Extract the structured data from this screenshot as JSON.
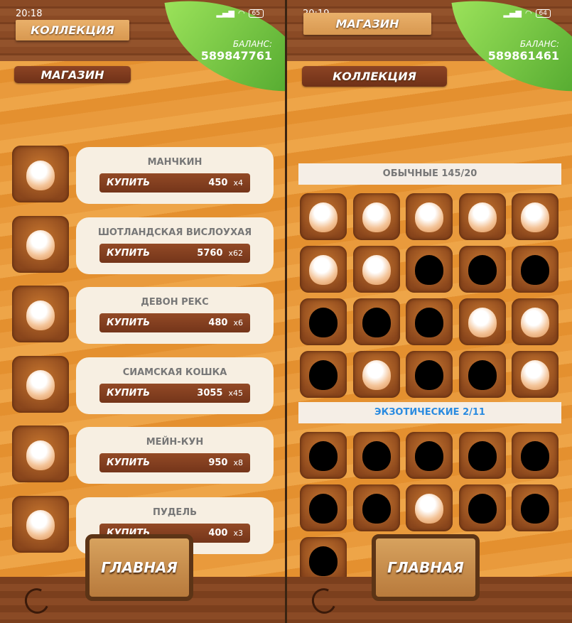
{
  "shop": {
    "time": "20:18",
    "battery": "65",
    "top_button": "КОЛЛЕКЦИЯ",
    "current_button": "МАГАЗИН",
    "balance_label": "БАЛАНС:",
    "balance": "589847761",
    "buy_label": "КУПИТЬ",
    "items": [
      {
        "name": "МАНЧКИН",
        "price": "450",
        "mult": "x4"
      },
      {
        "name": "ШОТЛАНДСКАЯ ВИСЛОУХАЯ",
        "price": "5760",
        "mult": "x62"
      },
      {
        "name": "ДЕВОН РЕКС",
        "price": "480",
        "mult": "x6"
      },
      {
        "name": "СИАМСКАЯ КОШКА",
        "price": "3055",
        "mult": "x45"
      },
      {
        "name": "МЕЙН-КУН",
        "price": "950",
        "mult": "x8"
      },
      {
        "name": "ПУДЕЛЬ",
        "price": "400",
        "mult": "x3"
      }
    ],
    "home_button": "ГЛАВНАЯ"
  },
  "collection": {
    "time": "20:19",
    "battery": "64",
    "top_button": "МАГАЗИН",
    "current_button": "КОЛЛЕКЦИЯ",
    "balance_label": "БАЛАНС:",
    "balance": "589861461",
    "common_title": "ОБЫЧНЫЕ 145/20",
    "common_unlocked": [
      true,
      true,
      true,
      true,
      true,
      true,
      true,
      false,
      false,
      false,
      false,
      false,
      false,
      true,
      true,
      false,
      true,
      false,
      false,
      true
    ],
    "exotic_title": "ЭКЗОТИЧЕСКИЕ 2/11",
    "exotic_unlocked": [
      false,
      false,
      false,
      false,
      false,
      false,
      false,
      true,
      false,
      false,
      false
    ],
    "home_button": "ГЛАВНАЯ"
  },
  "colors": {
    "accent_blue": "#2a8be0",
    "leaf": "#6cc23a",
    "wood_dark": "#7a3f1e"
  }
}
